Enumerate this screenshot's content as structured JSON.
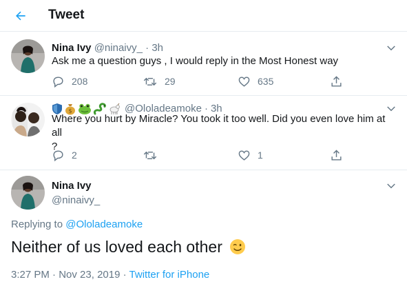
{
  "header": {
    "title": "Tweet"
  },
  "tweet1": {
    "name": "Nina Ivy",
    "handle": "@ninaivy_",
    "sep": "·",
    "time": "3h",
    "text": "Ask me a question guys , I would reply in the Most Honest way",
    "replies": "208",
    "retweets": "29",
    "likes": "635"
  },
  "tweet2": {
    "handle": "@Ololadeamoke",
    "sep": "·",
    "time": "3h",
    "text_line1": "Where you hurt by Miracle? You took it too well. Did you even love him at all",
    "text_line2": "?",
    "replies": "2",
    "likes": "1",
    "name_icons": [
      "shield-icon",
      "money-bag-icon",
      "frog-icon",
      "snake-icon",
      "goat-icon"
    ]
  },
  "main": {
    "name": "Nina Ivy",
    "handle": "@ninaivy_",
    "replying_prefix": "Replying to",
    "replying_to": "@Ololadeamoke",
    "text": "Neither of us loved each other",
    "time": "3:27 PM",
    "sep": "·",
    "date": "Nov 23, 2019",
    "source": "Twitter for iPhone"
  },
  "colors": {
    "accent": "#1da1f2",
    "muted": "#657786",
    "divider": "#e6ecf0"
  }
}
